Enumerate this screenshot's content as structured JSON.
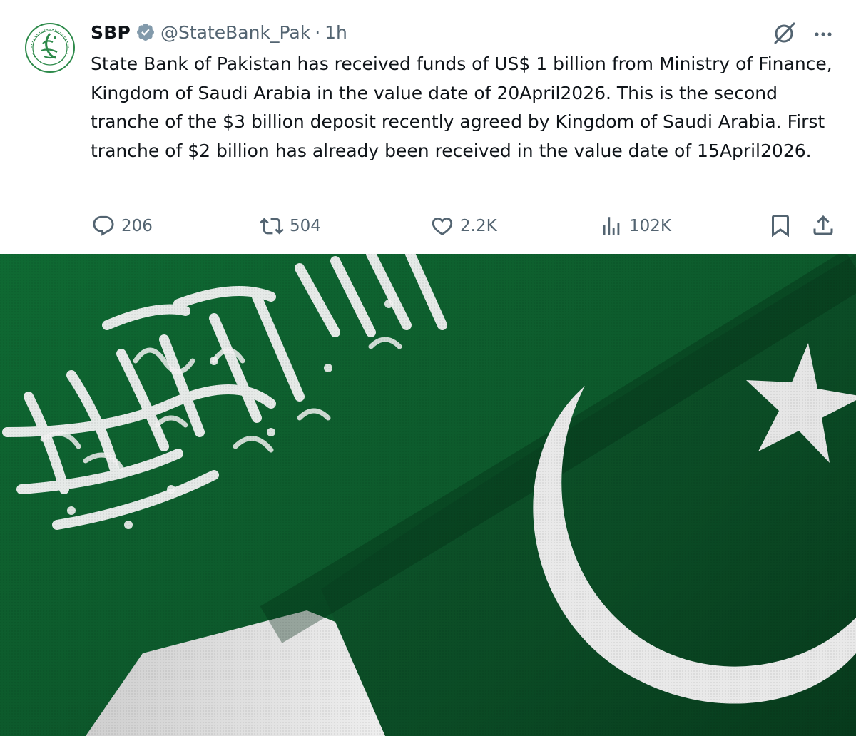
{
  "tweet": {
    "author": {
      "display_name": "SBP",
      "handle": "@StateBank_Pak",
      "separator": "·",
      "time": "1h"
    },
    "text": "State Bank of Pakistan has received funds of US$ 1 billion from Ministry of Finance, Kingdom of Saudi Arabia in the value date of 20April2026. This is the second tranche of the $3 billion deposit recently agreed by Kingdom of Saudi Arabia. First tranche of $2 billion has already been received in the value date of 15April2026.",
    "actions": {
      "replies": "206",
      "reposts": "504",
      "likes": "2.2K",
      "views": "102K"
    }
  },
  "icons": {
    "verified": "verified-badge-icon",
    "grok": "grok-icon",
    "more": "more-icon",
    "reply": "reply-icon",
    "repost": "repost-icon",
    "like": "heart-icon",
    "views": "views-icon",
    "bookmark": "bookmark-icon",
    "share": "share-icon"
  },
  "colors": {
    "text": "#0f1419",
    "secondary": "#536471",
    "verified": "#829aab",
    "flag_green": "#0f5a2c",
    "flag_white": "#f2f2f2"
  }
}
